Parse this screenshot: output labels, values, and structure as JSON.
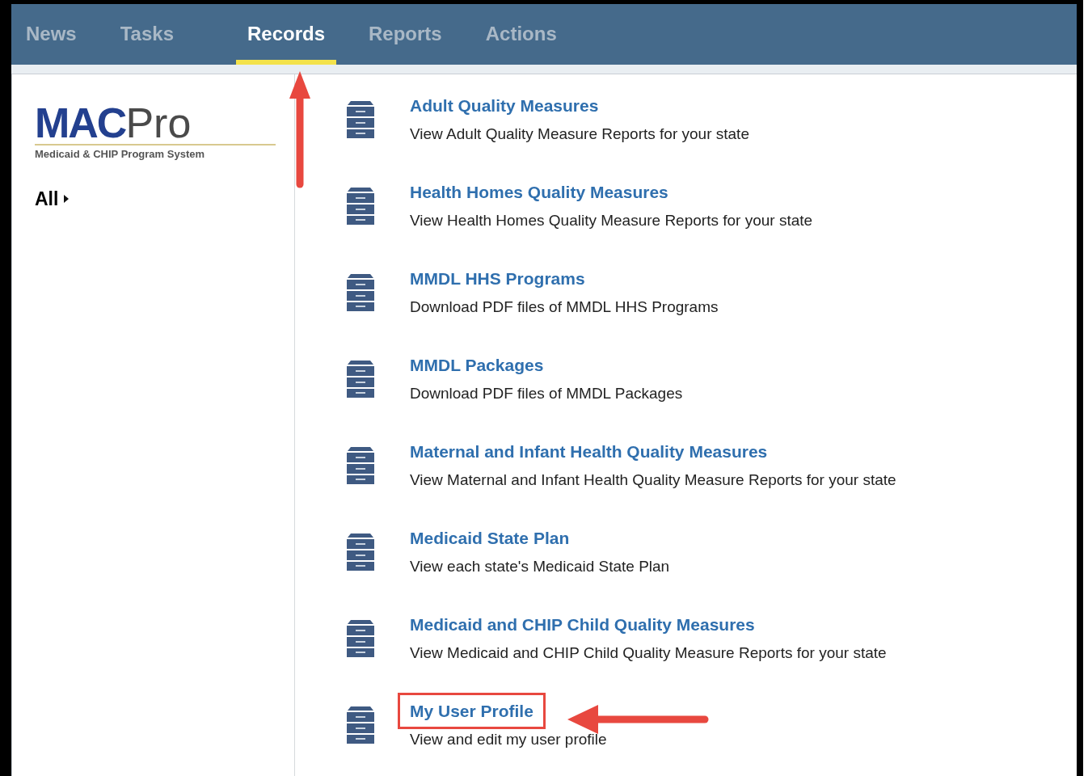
{
  "tabs": [
    {
      "label": "News",
      "selected": false
    },
    {
      "label": "Tasks",
      "selected": false
    },
    {
      "label": "Records",
      "selected": true
    },
    {
      "label": "Reports",
      "selected": false
    },
    {
      "label": "Actions",
      "selected": false
    }
  ],
  "logo": {
    "mark": "MAC",
    "name": "Pro",
    "tagline": "Medicaid & CHIP Program System"
  },
  "sidebar": {
    "filter": "All"
  },
  "records": [
    {
      "title": "Adult Quality Measures",
      "description": "View Adult Quality Measure Reports for your state",
      "highlighted": false
    },
    {
      "title": "Health Homes Quality Measures",
      "description": "View Health Homes Quality Measure Reports for your state",
      "highlighted": false
    },
    {
      "title": "MMDL HHS Programs",
      "description": "Download PDF files of MMDL HHS Programs",
      "highlighted": false
    },
    {
      "title": "MMDL Packages",
      "description": "Download PDF files of MMDL Packages",
      "highlighted": false
    },
    {
      "title": "Maternal and Infant Health Quality Measures",
      "description": "View Maternal and Infant Health Quality Measure Reports for your state",
      "highlighted": false
    },
    {
      "title": "Medicaid State Plan",
      "description": "View each state's Medicaid State Plan",
      "highlighted": false
    },
    {
      "title": "Medicaid and CHIP Child Quality Measures",
      "description": "View Medicaid and CHIP Child Quality Measure Reports for your state",
      "highlighted": false
    },
    {
      "title": "My User Profile",
      "description": "View and edit my user profile",
      "highlighted": true
    }
  ]
}
